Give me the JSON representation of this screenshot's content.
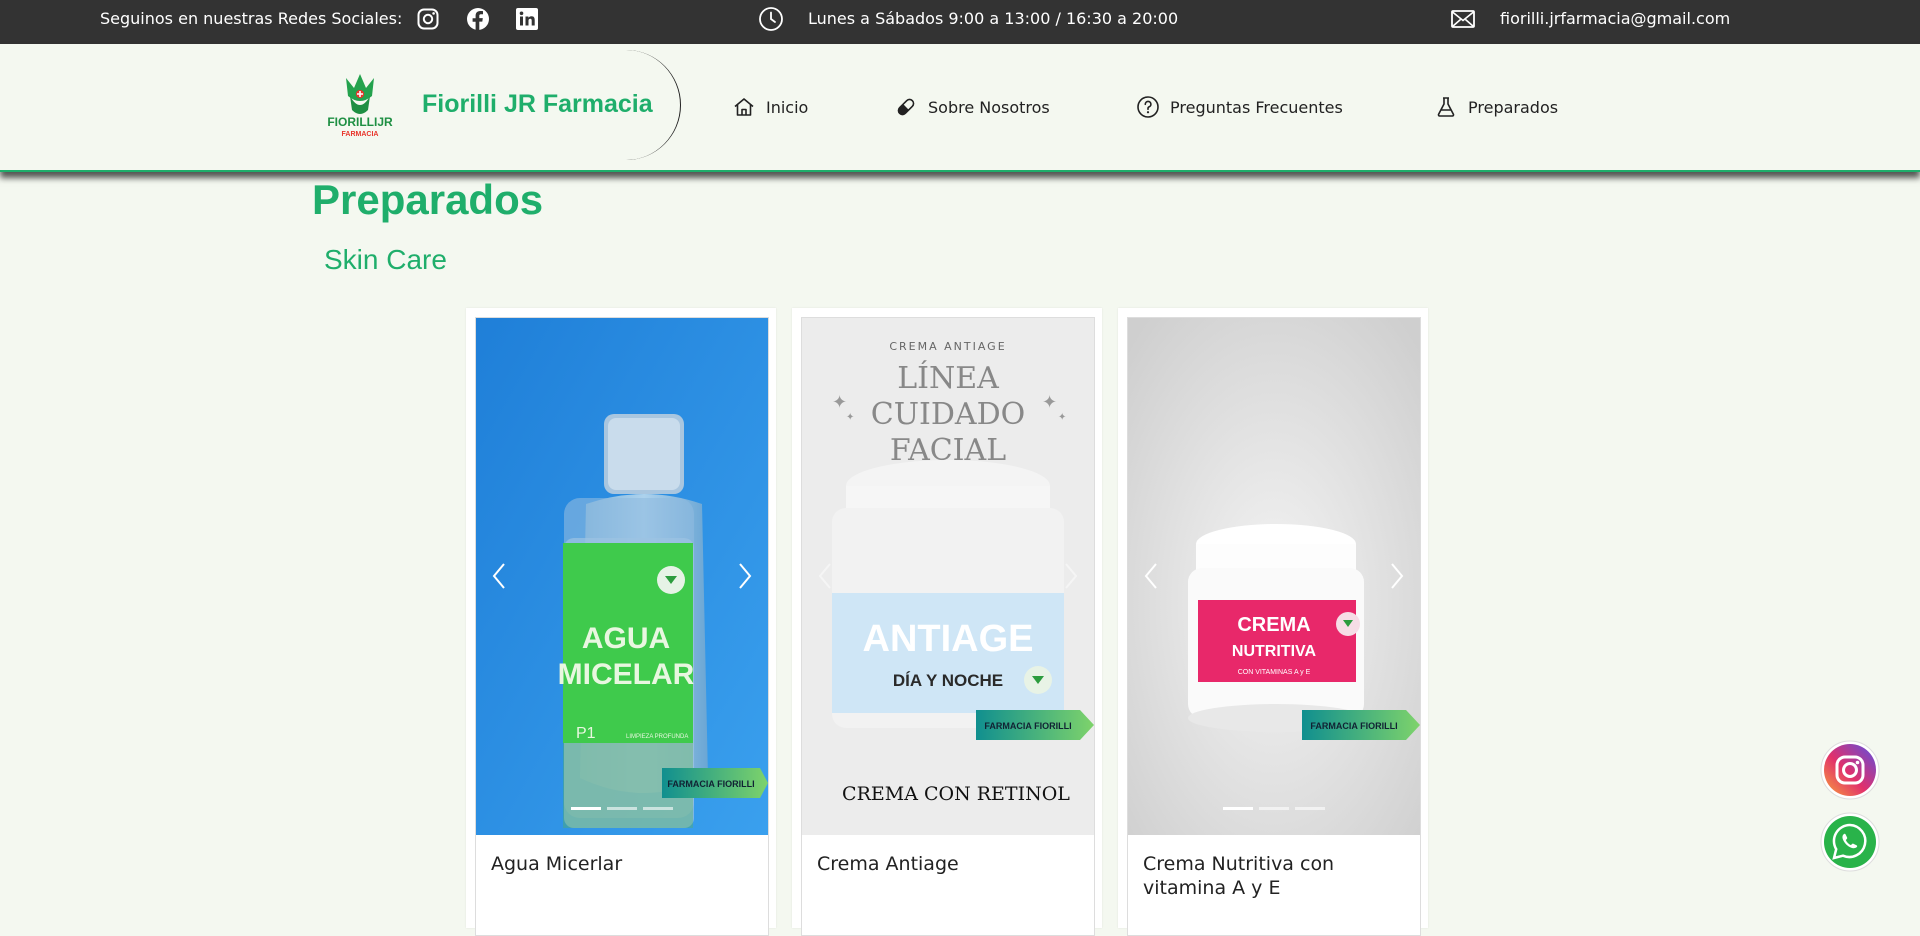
{
  "topbar": {
    "social_label": "Seguinos en nuestras Redes Sociales:",
    "hours": "Lunes a Sábados 9:00 a 13:00 / 16:30 a 20:00",
    "email": "fiorilli.jrfarmacia@gmail.com"
  },
  "header": {
    "brand": "Fiorilli JR Farmacia",
    "logo_text_top": "FIORILLIJR",
    "logo_text_bottom": "FARMACIA"
  },
  "nav": [
    {
      "label": "Inicio",
      "icon": "home-icon"
    },
    {
      "label": "Sobre Nosotros",
      "icon": "capsule-icon"
    },
    {
      "label": "Preguntas Frecuentes",
      "icon": "question-icon"
    },
    {
      "label": "Preparados",
      "icon": "flask-icon"
    }
  ],
  "main": {
    "title": "Preparados",
    "section": "Skin Care",
    "cards": [
      {
        "caption": "Agua Micerlar",
        "label_line1": "AGUA",
        "label_line2": "MICELAR",
        "badge": "FARMACIA FIORILLI",
        "small1": "P1",
        "small2": "LIMPIEZA PROFUNDA"
      },
      {
        "caption": "Crema Antiage",
        "header_small": "CREMA ANTIAGE",
        "header_line1": "LÍNEA",
        "header_line2": "CUIDADO",
        "header_line3": "FACIAL",
        "label_line1": "ANTIAGE",
        "label_line2": "DÍA Y NOCHE",
        "badge": "FARMACIA FIORILLI",
        "footer": "CREMA CON RETINOL"
      },
      {
        "caption": "Crema Nutritiva con vitamina A y E",
        "label_line1": "CREMA",
        "label_line2": "NUTRITIVA",
        "label_line3": "CON VITAMINAS A y E",
        "badge": "FARMACIA FIORILLI"
      }
    ]
  },
  "colors": {
    "brand_green": "#1fae6b",
    "topbar": "#333333",
    "background": "#f4f8f0"
  }
}
